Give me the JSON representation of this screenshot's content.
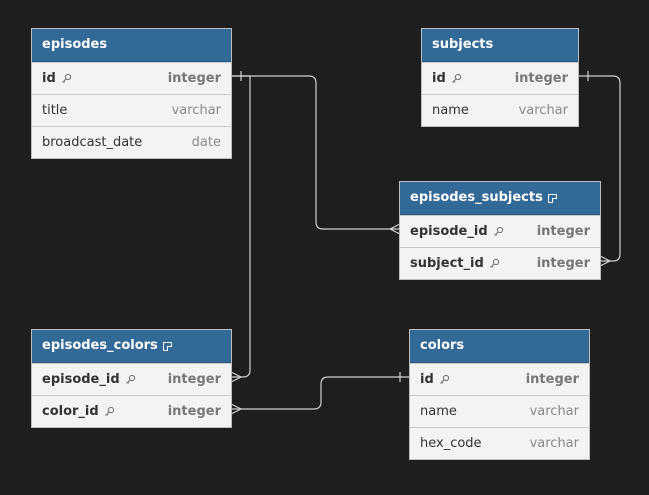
{
  "tables": {
    "episodes": {
      "name": "episodes",
      "has_note": false,
      "columns": [
        {
          "name": "id",
          "type": "integer",
          "key": true
        },
        {
          "name": "title",
          "type": "varchar",
          "key": false
        },
        {
          "name": "broadcast_date",
          "type": "date",
          "key": false
        }
      ]
    },
    "subjects": {
      "name": "subjects",
      "has_note": false,
      "columns": [
        {
          "name": "id",
          "type": "integer",
          "key": true
        },
        {
          "name": "name",
          "type": "varchar",
          "key": false
        }
      ]
    },
    "episodes_subjects": {
      "name": "episodes_subjects",
      "has_note": true,
      "columns": [
        {
          "name": "episode_id",
          "type": "integer",
          "key": true
        },
        {
          "name": "subject_id",
          "type": "integer",
          "key": true
        }
      ]
    },
    "episodes_colors": {
      "name": "episodes_colors",
      "has_note": true,
      "columns": [
        {
          "name": "episode_id",
          "type": "integer",
          "key": true
        },
        {
          "name": "color_id",
          "type": "integer",
          "key": true
        }
      ]
    },
    "colors": {
      "name": "colors",
      "has_note": false,
      "columns": [
        {
          "name": "id",
          "type": "integer",
          "key": true
        },
        {
          "name": "name",
          "type": "varchar",
          "key": false
        },
        {
          "name": "hex_code",
          "type": "varchar",
          "key": false
        }
      ]
    }
  },
  "relationships": [
    {
      "from": "episodes.id",
      "to": "episodes_subjects.episode_id",
      "cardinality": "one-to-many"
    },
    {
      "from": "subjects.id",
      "to": "episodes_subjects.subject_id",
      "cardinality": "one-to-many"
    },
    {
      "from": "episodes.id",
      "to": "episodes_colors.episode_id",
      "cardinality": "one-to-many"
    },
    {
      "from": "colors.id",
      "to": "episodes_colors.color_id",
      "cardinality": "one-to-many"
    }
  ],
  "colors": {
    "background": "#1e1e1f",
    "header": "#336996",
    "body": "#f3f3f3",
    "link": "#d0d0d0"
  }
}
